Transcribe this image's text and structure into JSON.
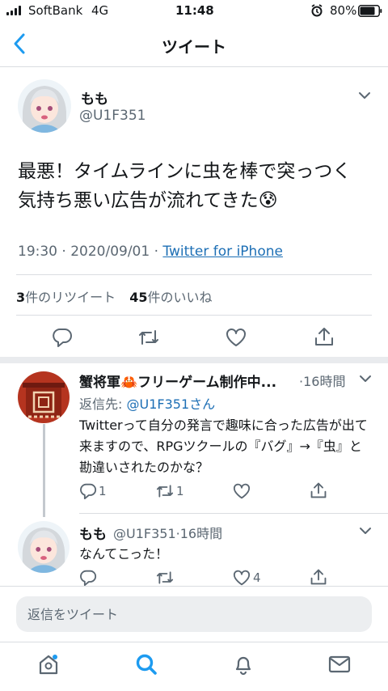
{
  "status_bar": {
    "carrier": "SoftBank",
    "network": "4G",
    "time": "11:48",
    "battery": "80%"
  },
  "header": {
    "title": "ツイート"
  },
  "main_tweet": {
    "name": "もも",
    "handle": "@U1F351",
    "text": "最悪！タイムラインに虫を棒で突っつく気持ち悪い広告が流れてきた😰",
    "timestamp": "19:30 · 2020/09/01 · ",
    "source": "Twitter for iPhone",
    "retweets_count": "3",
    "retweets_label": "件のリツイート",
    "likes_count": "45",
    "likes_label": "件のいいね"
  },
  "reply1": {
    "name": "蟹将軍🦀フリーゲーム制作中...",
    "time": "·16時間",
    "reply_to_label": "返信先: ",
    "reply_to_handle": "@U1F351さん",
    "text": "Twitterって自分の発言で趣味に合った広告が出て来ますので、RPGツクールの『バグ』→『虫』と勘違いされたのかな？",
    "reply_count": "1",
    "retweet_count": "1",
    "like_count": ""
  },
  "reply2": {
    "name": "もも",
    "handle_time": "@U1F351·16時間",
    "text": "なんてこった！",
    "reply_count": "",
    "retweet_count": "",
    "like_count": "4"
  },
  "composer": {
    "placeholder": "返信をツイート"
  },
  "icons": {
    "back": "chevron-left-icon",
    "more": "chevron-down-icon",
    "reply": "reply-icon",
    "retweet": "retweet-icon",
    "like": "heart-icon",
    "share": "share-icon",
    "home": "home-icon",
    "search": "search-icon",
    "notifications": "bell-icon",
    "messages": "mail-icon"
  },
  "colors": {
    "accent": "#1d9bf0",
    "link": "#1d6fb5",
    "text": "#14171a",
    "muted": "#5b6772"
  }
}
